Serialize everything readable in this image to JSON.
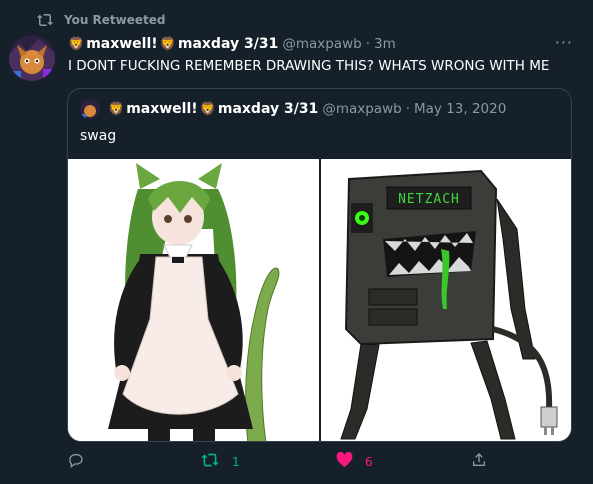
{
  "retweet_label": "You Retweeted",
  "tweet": {
    "display_name": "maxwell!",
    "name_suffix": "maxday 3/31",
    "handle": "@maxpawb",
    "separator": "·",
    "time": "3m",
    "more": "···",
    "text": "I DONT FUCKING REMEMBER DRAWING THIS? WHATS WRONG WITH ME"
  },
  "quote": {
    "display_name": "maxwell!",
    "name_suffix": "maxday 3/31",
    "handle": "@maxpawb",
    "separator": "·",
    "date": "May 13, 2020",
    "text": "swag",
    "sign_text": "NETZACH"
  },
  "actions": {
    "retweet_count": "1",
    "like_count": "6"
  },
  "colors": {
    "background": "#15202b",
    "retweet_green": "#00ba7c",
    "like_pink": "#f91880",
    "muted": "#8b98a5"
  }
}
